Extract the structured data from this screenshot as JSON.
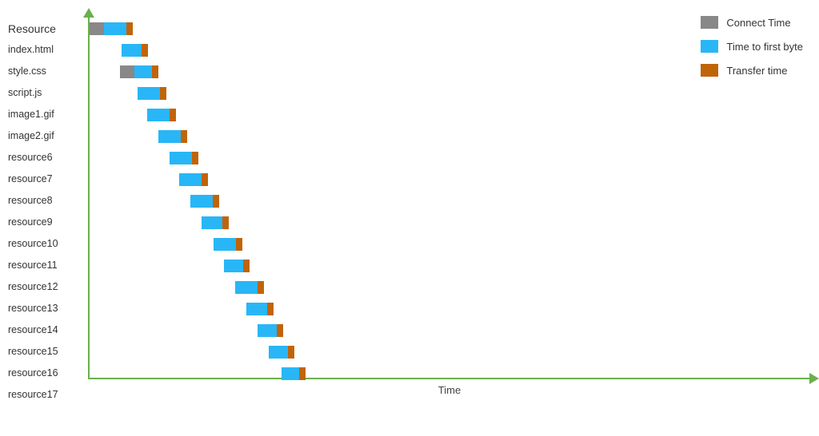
{
  "chart": {
    "title": "Resource",
    "xAxisLabel": "Time",
    "yLabels": [
      "index.html",
      "style.css",
      "script.js",
      "image1.gif",
      "image2.gif",
      "resource6",
      "resource7",
      "resource8",
      "resource9",
      "resource10",
      "resource11",
      "resource12",
      "resource13",
      "resource14",
      "resource15",
      "resource16",
      "resource17"
    ],
    "legend": [
      {
        "label": "Connect Time",
        "color": "#888888",
        "type": "connect"
      },
      {
        "label": "Time to first byte",
        "color": "#29b6f6",
        "type": "ttfb"
      },
      {
        "label": "Transfer time",
        "color": "#c0640a",
        "type": "transfer"
      }
    ],
    "bars": [
      {
        "offset": 0,
        "connect": 18,
        "ttfb": 28,
        "transfer": 8
      },
      {
        "offset": 40,
        "connect": 0,
        "ttfb": 25,
        "transfer": 8
      },
      {
        "offset": 38,
        "connect": 18,
        "ttfb": 22,
        "transfer": 8
      },
      {
        "offset": 60,
        "connect": 0,
        "ttfb": 28,
        "transfer": 8
      },
      {
        "offset": 72,
        "connect": 0,
        "ttfb": 28,
        "transfer": 8
      },
      {
        "offset": 86,
        "connect": 0,
        "ttfb": 28,
        "transfer": 8
      },
      {
        "offset": 100,
        "connect": 0,
        "ttfb": 28,
        "transfer": 8
      },
      {
        "offset": 112,
        "connect": 0,
        "ttfb": 28,
        "transfer": 8
      },
      {
        "offset": 126,
        "connect": 0,
        "ttfb": 28,
        "transfer": 8
      },
      {
        "offset": 140,
        "connect": 0,
        "ttfb": 26,
        "transfer": 8
      },
      {
        "offset": 155,
        "connect": 0,
        "ttfb": 28,
        "transfer": 8
      },
      {
        "offset": 168,
        "connect": 0,
        "ttfb": 24,
        "transfer": 8
      },
      {
        "offset": 182,
        "connect": 0,
        "ttfb": 28,
        "transfer": 8
      },
      {
        "offset": 196,
        "connect": 0,
        "ttfb": 26,
        "transfer": 8
      },
      {
        "offset": 210,
        "connect": 0,
        "ttfb": 24,
        "transfer": 8
      },
      {
        "offset": 224,
        "connect": 0,
        "ttfb": 24,
        "transfer": 8
      },
      {
        "offset": 240,
        "connect": 0,
        "ttfb": 22,
        "transfer": 8
      }
    ]
  }
}
